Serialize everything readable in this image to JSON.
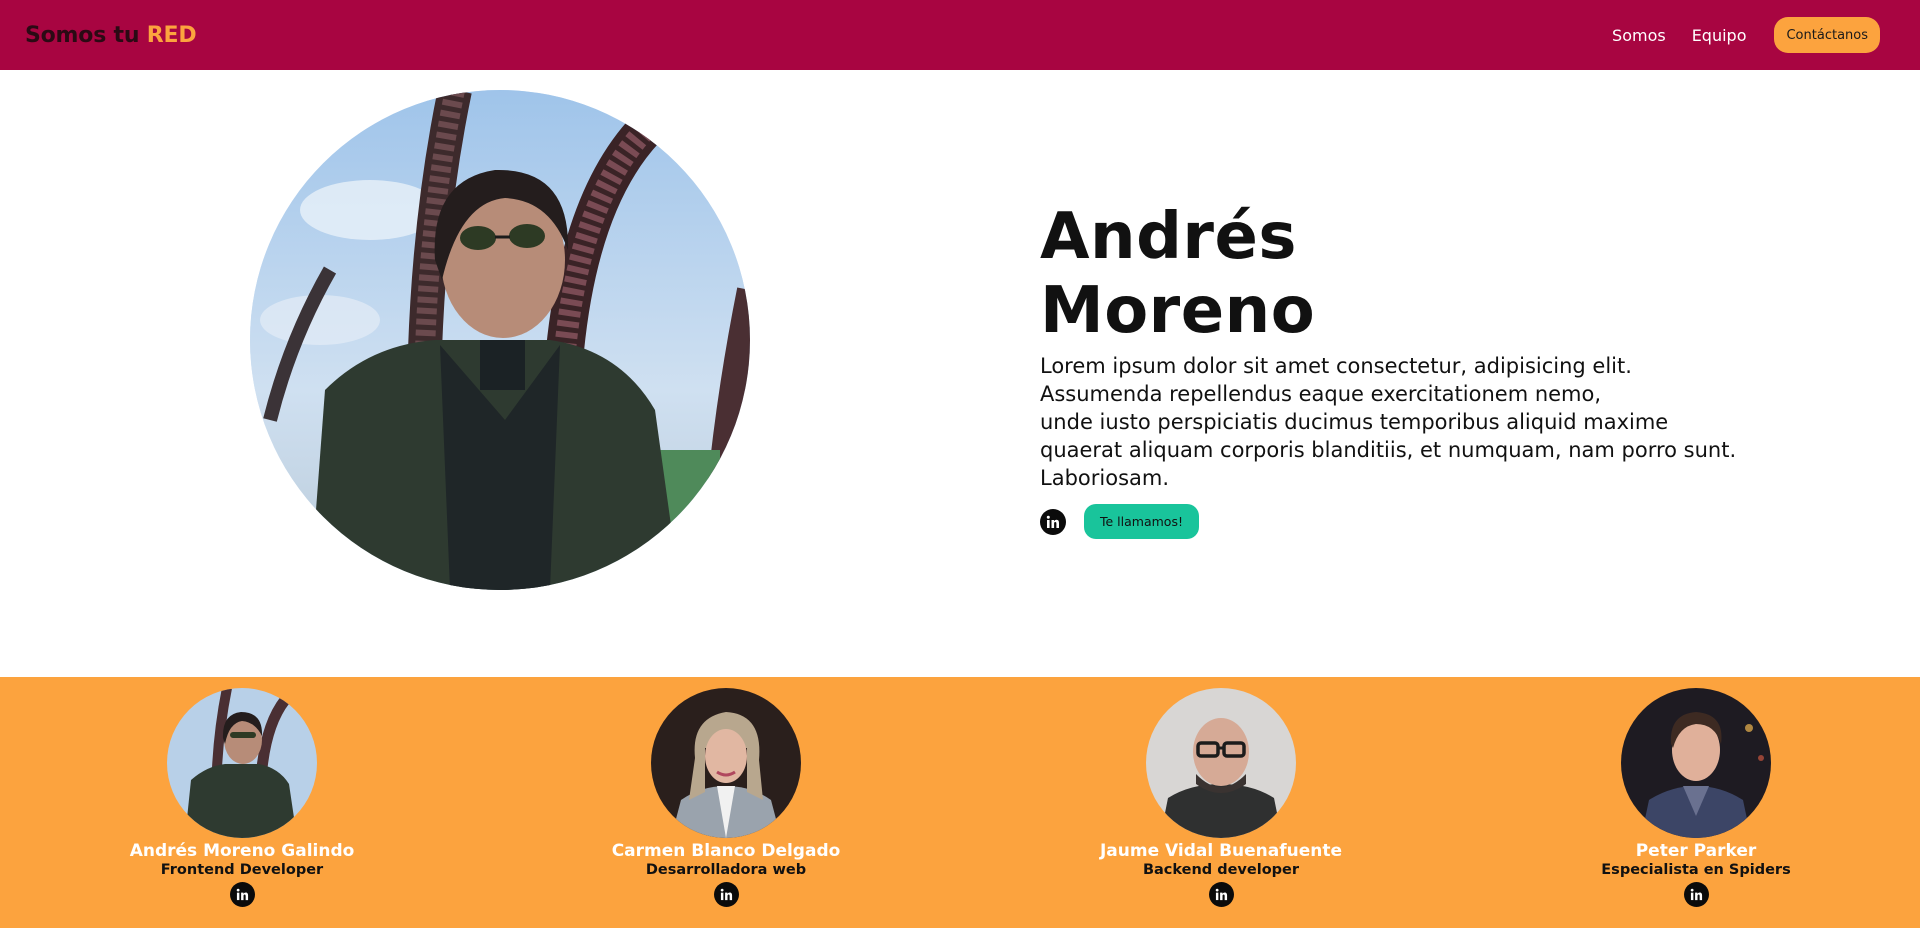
{
  "navbar": {
    "brand_prefix": "Somos tu ",
    "brand_accent": "RED",
    "links": [
      "Somos",
      "Equipo"
    ],
    "cta_label": "Contáctanos"
  },
  "hero": {
    "name_line1": "Andrés",
    "name_line2": "Moreno",
    "bio_lines": [
      "Lorem ipsum dolor sit amet consectetur, adipisicing elit.",
      "Assumenda repellendus eaque exercitationem nemo,",
      "unde iusto perspiciatis ducimus temporibus aliquid maxime",
      "quaerat aliquam corporis blanditiis, et numquam, nam porro sunt.",
      "Laboriosam."
    ],
    "linkedin_icon": "linkedin-icon",
    "call_button_label": "Te llamamos!"
  },
  "team": {
    "members": [
      {
        "name": "Andrés Moreno Galindo",
        "role": "Frontend Developer"
      },
      {
        "name": "Carmen Blanco Delgado",
        "role": "Desarrolladora web"
      },
      {
        "name": "Jaume Vidal Buenafuente",
        "role": "Backend developer"
      },
      {
        "name": "Peter Parker",
        "role": "Especialista en Spiders"
      }
    ]
  },
  "colors": {
    "navbar_bg": "#a80541",
    "accent_orange": "#fca33e",
    "call_button_green": "#19c49b",
    "text_dark": "#111111"
  }
}
